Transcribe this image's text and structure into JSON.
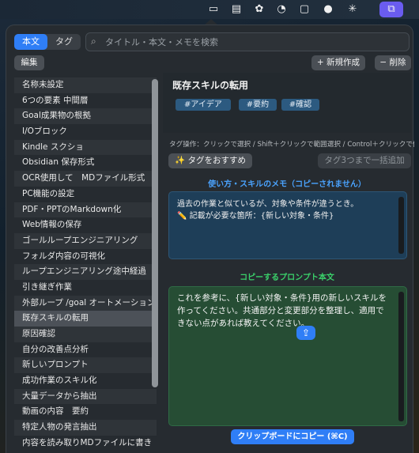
{
  "tabs": {
    "body": "本文",
    "tag": "タグ"
  },
  "search": {
    "placeholder": "タイトル・本文・メモを検索"
  },
  "toolbar": {
    "edit": "編集",
    "new": "+ 新規作成",
    "delete": "− 削除"
  },
  "sidebar": {
    "items": [
      "名称未設定",
      "6つの要素 中間層",
      "Goal成果物の根拠",
      "I/Oブロック",
      "Kindle スクショ",
      "Obsidian 保存形式",
      "OCR使用して　MDファイル形式",
      "PC機能の設定",
      "PDF・PPTのMarkdown化",
      "Web情報の保存",
      "ゴールループエンジニアリング",
      "フォルダ内容の可視化",
      "ループエンジニアリング途中経過",
      "引き継ぎ作業",
      "外部ループ /goal オートメーション",
      "既存スキルの転用",
      "原因確認",
      "自分の改善点分析",
      "新しいプロンプト",
      "成功作業のスキル化",
      "大量データから抽出",
      "動画の内容　要約",
      "特定人物の発言抽出",
      "内容を読み取りMDファイルに書き"
    ],
    "selected_index": 15
  },
  "detail": {
    "title": "既存スキルの転用",
    "tags": [
      "#アイデア",
      "#要約",
      "#確認"
    ],
    "tag_hint": "タグ操作：クリックで選択 / Shift＋クリックで範囲選択 / Control＋クリックで個別選択，",
    "recommend_button": "✨ タグをおすすめ",
    "bulk_add_button": "タグ3つまで一括追加",
    "memo_label": "使い方・スキルのメモ（コピーされません）",
    "memo_line1": "過去の作業と似ているが、対象や条件が違うとき。",
    "memo_line2": "✏️ 記載が必要な箇所：{新しい対象・条件}",
    "prompt_label": "コピーするプロンプト本文",
    "prompt_text": "これを参考に、{新しい対象・条件}用の新しいスキルを作ってください。共通部分と変更部分を整理し、適用できない点があれば教えてください。",
    "copy_button": "クリップボードにコピー (⌘C)"
  },
  "colors": {
    "accent": "#2f7ef6",
    "memo_label": "#4aa3ff",
    "prompt_label": "#3ad06a",
    "tag_bg": "#2c5a80"
  }
}
